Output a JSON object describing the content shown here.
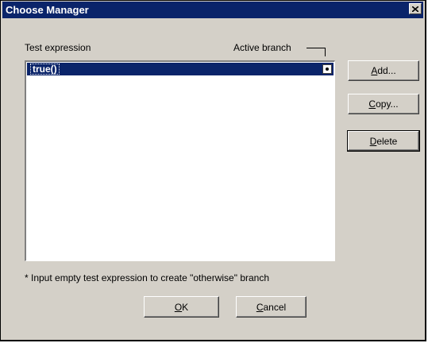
{
  "window": {
    "title": "Choose Manager"
  },
  "labels": {
    "test_expression": "Test expression",
    "active_branch": "Active branch"
  },
  "list": {
    "items": [
      {
        "expression": "true()",
        "active": true,
        "selected": true
      }
    ]
  },
  "buttons": {
    "add": {
      "mnemonic": "A",
      "rest": "dd..."
    },
    "copy": {
      "mnemonic": "C",
      "rest": "opy..."
    },
    "delete": {
      "mnemonic": "D",
      "rest": "elete"
    },
    "ok": {
      "mnemonic": "O",
      "rest": "K"
    },
    "cancel": {
      "mnemonic": "C",
      "rest": "ancel"
    }
  },
  "hint": "* Input empty test expression to create \"otherwise\" branch",
  "icons": {
    "close": "close-icon",
    "radio": "radio-selected-icon"
  }
}
